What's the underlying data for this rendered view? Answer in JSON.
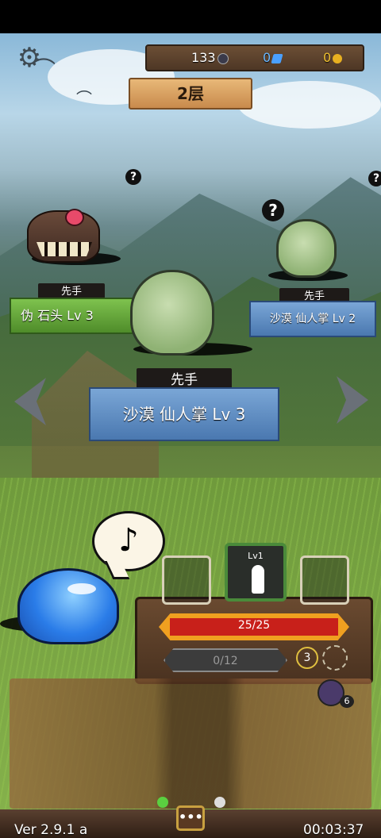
{
  "resources": {
    "orbs": "133",
    "crystals": "0",
    "gold": "0"
  },
  "floor": "2层",
  "enemies": [
    {
      "initiative": "先手",
      "name": "伪 石头 Lv 3"
    },
    {
      "initiative": "先手",
      "name": "沙漠 仙人掌 Lv 2"
    },
    {
      "initiative": "先手",
      "name": "沙漠 仙人掌 Lv 3"
    }
  ],
  "unknown_marker": "?",
  "speech_icon": "music-note-icon",
  "card_level": "Lv1",
  "hp": "25/25",
  "xp": "0/12",
  "slot_count": "3",
  "bag_count": "6",
  "menu_label": "•••",
  "version": "Ver 2.9.1 a",
  "timer": "00:03:37",
  "colors": {
    "hp_fill": "#c8201a",
    "hp_frame": "#f0a020",
    "green_plate": "#5f9e34",
    "blue_plate": "#5a88c0"
  }
}
